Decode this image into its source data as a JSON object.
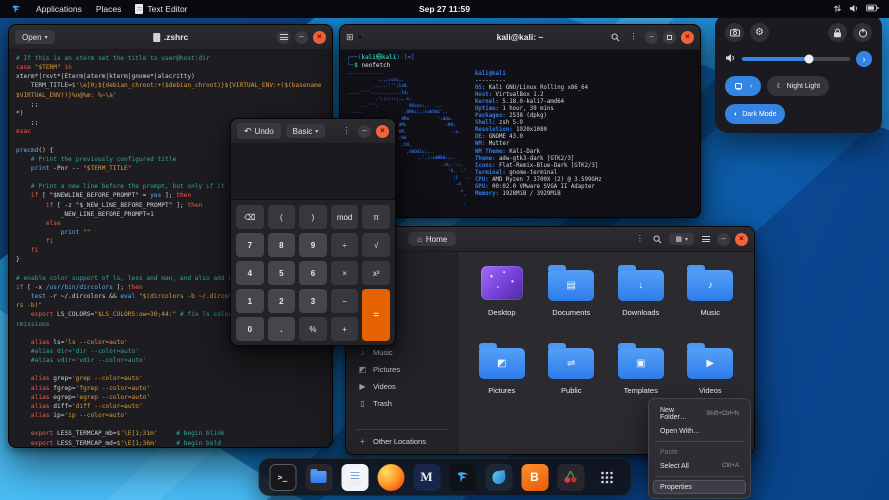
{
  "topbar": {
    "applications": "Applications",
    "places": "Places",
    "focused_app": "Text Editor",
    "clock": "Sep 27 11:59"
  },
  "editor": {
    "open_label": "Open",
    "title": ".zshrc",
    "code": [
      [
        [
          "c",
          "# If this is an xterm set the title to user@host:dir"
        ]
      ],
      [
        [
          "k",
          "case"
        ],
        [
          "p",
          " "
        ],
        [
          "s",
          "\"$TERM\""
        ],
        [
          "p",
          " "
        ],
        [
          "k",
          "in"
        ]
      ],
      [
        [
          "p",
          "xterm*|rxvt*|Eterm|aterm|kterm|gnome*|alacritty)"
        ]
      ],
      [
        [
          "p",
          "    TERM_TITLE="
        ],
        [
          "s",
          "$'\\e]0;${debian_chroot:+($debian_chroot)}${VIRTUAL_ENV:+($(basename $VIRTUAL_ENV))}%n@%m: %~\\a'"
        ]
      ],
      [
        [
          "p",
          "    ;;"
        ]
      ],
      [
        [
          "p",
          "*)"
        ]
      ],
      [
        [
          "p",
          "    ;;"
        ]
      ],
      [
        [
          "k",
          "esac"
        ]
      ],
      [],
      [
        [
          "v",
          "precmd"
        ],
        [
          "p",
          "() {"
        ]
      ],
      [
        [
          "c",
          "    # Print the previously configured title"
        ]
      ],
      [
        [
          "p",
          "    "
        ],
        [
          "v",
          "print"
        ],
        [
          "p",
          " -Pnr -- "
        ],
        [
          "s",
          "\"$TERM_TITLE\""
        ]
      ],
      [],
      [
        [
          "c",
          "    # Print a new line before the prompt, but only if it is not the first line"
        ]
      ],
      [
        [
          "p",
          "    "
        ],
        [
          "k",
          "if"
        ],
        [
          "p",
          " [ \"$NEWLINE_BEFORE_PROMPT\" = "
        ],
        [
          "v",
          "yes"
        ],
        [
          "p",
          " ]; "
        ],
        [
          "k",
          "then"
        ]
      ],
      [
        [
          "p",
          "        "
        ],
        [
          "k",
          "if"
        ],
        [
          "p",
          " [ -z \"$_NEW_LINE_BEFORE_PROMPT\" ]; "
        ],
        [
          "k",
          "then"
        ]
      ],
      [
        [
          "p",
          "            _NEW_LINE_BEFORE_PROMPT=1"
        ]
      ],
      [
        [
          "p",
          "        "
        ],
        [
          "k",
          "else"
        ]
      ],
      [
        [
          "p",
          "            "
        ],
        [
          "v",
          "print"
        ],
        [
          "p",
          " "
        ],
        [
          "s",
          "\"\""
        ]
      ],
      [
        [
          "p",
          "        "
        ],
        [
          "k",
          "fi"
        ]
      ],
      [
        [
          "p",
          "    "
        ],
        [
          "k",
          "fi"
        ]
      ],
      [
        [
          "p",
          "}"
        ]
      ],
      [],
      [
        [
          "c",
          "# enable color support of ls, less and man, and also add handy aliases"
        ]
      ],
      [
        [
          "k",
          "if"
        ],
        [
          "p",
          " [ -x "
        ],
        [
          "v",
          "/usr/bin/dircolors"
        ],
        [
          "p",
          " ]; "
        ],
        [
          "k",
          "then"
        ]
      ],
      [
        [
          "p",
          "    "
        ],
        [
          "v",
          "test"
        ],
        [
          "p",
          " -r ~/.dircolors && "
        ],
        [
          "v",
          "eval"
        ],
        [
          "p",
          " "
        ],
        [
          "s",
          "\"$(dircolors -b ~/.dircolors)\""
        ],
        [
          "p",
          " || "
        ],
        [
          "v",
          "eval"
        ],
        [
          "p",
          " "
        ],
        [
          "s",
          "\"$(dircolors -b)\""
        ]
      ],
      [
        [
          "p",
          "    "
        ],
        [
          "k",
          "export"
        ],
        [
          "p",
          " LS_COLORS="
        ],
        [
          "s",
          "\"$LS_COLORS:ow=30;44:\""
        ],
        [
          "p",
          " "
        ],
        [
          "c",
          "# fix ls color for folders with 777 permissions"
        ]
      ],
      [],
      [
        [
          "p",
          "    "
        ],
        [
          "k",
          "alias"
        ],
        [
          "p",
          " ls="
        ],
        [
          "s",
          "'ls --color=auto'"
        ]
      ],
      [
        [
          "c",
          "    #alias dir='dir --color=auto'"
        ]
      ],
      [
        [
          "c",
          "    #alias vdir='vdir --color=auto'"
        ]
      ],
      [],
      [
        [
          "p",
          "    "
        ],
        [
          "k",
          "alias"
        ],
        [
          "p",
          " grep="
        ],
        [
          "s",
          "'grep --color=auto'"
        ]
      ],
      [
        [
          "p",
          "    "
        ],
        [
          "k",
          "alias"
        ],
        [
          "p",
          " fgrep="
        ],
        [
          "s",
          "'fgrep --color=auto'"
        ]
      ],
      [
        [
          "p",
          "    "
        ],
        [
          "k",
          "alias"
        ],
        [
          "p",
          " egrep="
        ],
        [
          "s",
          "'egrep --color=auto'"
        ]
      ],
      [
        [
          "p",
          "    "
        ],
        [
          "k",
          "alias"
        ],
        [
          "p",
          " diff="
        ],
        [
          "s",
          "'diff --color=auto'"
        ]
      ],
      [
        [
          "p",
          "    "
        ],
        [
          "k",
          "alias"
        ],
        [
          "p",
          " ip="
        ],
        [
          "s",
          "'ip --color=auto'"
        ]
      ],
      [],
      [
        [
          "p",
          "    "
        ],
        [
          "k",
          "export"
        ],
        [
          "p",
          " LESS_TERMCAP_mb="
        ],
        [
          "s",
          "$'\\E[1;31m'"
        ],
        [
          "p",
          "     "
        ],
        [
          "c",
          "# begin blink"
        ]
      ],
      [
        [
          "p",
          "    "
        ],
        [
          "k",
          "export"
        ],
        [
          "p",
          " LESS_TERMCAP_md="
        ],
        [
          "s",
          "$'\\E[1;36m'"
        ],
        [
          "p",
          "     "
        ],
        [
          "c",
          "# begin bold"
        ]
      ]
    ]
  },
  "terminal": {
    "title": "kali@kali: ~",
    "prompt": [
      [
        [
          "frame",
          "┌──("
        ],
        [
          "user",
          "kali㉿kali"
        ],
        [
          "frame",
          ")-["
        ],
        [
          "path",
          "~"
        ],
        [
          "frame",
          "]"
        ]
      ],
      [
        [
          "frame",
          "└─"
        ],
        [
          "user",
          "$"
        ],
        [
          "plain",
          " neofetch"
        ]
      ]
    ],
    "neofetch": {
      "user_host": "kali@kali",
      "separator": "---------",
      "art": [
        "..............",
        "            ..,;:ccc,.",
        "          ......''';lxO.",
        ".....''''..........,:ld;",
        "           .';;;:::;,,.x,",
        "      ..'''.            0Xxoc:,.  ...",
        "  ....                ,ONkc;,;cokOdc',.",
        " .                   OMo           ':ddo.",
        "                    dMc               :OO;",
        "                    0M.                 .:o.",
        "                    ;Wd",
        "                     ;XO,",
        "                       ,d0Odlc;,..",
        "                           ..',;:cdOOd::,.",
        "                                    .:d;.':;.",
        "                                       'd,  .'",
        "                                         ;l   ..",
        "                                          .o",
        "                                            c",
        "                                            .'",
        "                                             ."
      ],
      "info": [
        [
          "OS",
          "Kali GNU/Linux Rolling x86_64"
        ],
        [
          "Host",
          "VirtualBox 1.2"
        ],
        [
          "Kernel",
          "5.18.0-kali7-amd64"
        ],
        [
          "Uptime",
          "1 hour, 39 mins"
        ],
        [
          "Packages",
          "2538 (dpkg)"
        ],
        [
          "Shell",
          "zsh 5.9"
        ],
        [
          "Resolution",
          "1920x1080"
        ],
        [
          "DE",
          "GNOME 43.0"
        ],
        [
          "WM",
          "Mutter"
        ],
        [
          "WM Theme",
          "Kali-Dark"
        ],
        [
          "Theme",
          "adw-gtk3-dark [GTK2/3]"
        ],
        [
          "Icons",
          "Flat-Remix-Blue-Dark [GTK2/3]"
        ],
        [
          "Terminal",
          "gnome-terminal"
        ],
        [
          "CPU",
          "AMD Ryzen 7 3700X (2) @ 3.599GHz"
        ],
        [
          "GPU",
          "00:02.0 VMware SVGA II Adapter"
        ],
        [
          "Memory",
          "1928MiB / 3929MiB"
        ]
      ]
    }
  },
  "calculator": {
    "undo_label": "Undo",
    "mode_label": "Basic",
    "display": "",
    "buttons": [
      {
        "t": "⌫",
        "n": "backspace",
        "k": "fn"
      },
      {
        "t": "(",
        "n": "paren-open",
        "k": "fn"
      },
      {
        "t": ")",
        "n": "paren-close",
        "k": "fn"
      },
      {
        "t": "mod",
        "n": "mod",
        "k": "fn"
      },
      {
        "t": "π",
        "n": "pi",
        "k": "fn"
      },
      {
        "t": "7",
        "n": "7",
        "k": "num"
      },
      {
        "t": "8",
        "n": "8",
        "k": "num"
      },
      {
        "t": "9",
        "n": "9",
        "k": "num"
      },
      {
        "t": "÷",
        "n": "divide",
        "k": "fn"
      },
      {
        "t": "√",
        "n": "sqrt",
        "k": "fn"
      },
      {
        "t": "4",
        "n": "4",
        "k": "num"
      },
      {
        "t": "5",
        "n": "5",
        "k": "num"
      },
      {
        "t": "6",
        "n": "6",
        "k": "num"
      },
      {
        "t": "×",
        "n": "multiply",
        "k": "fn"
      },
      {
        "t": "x²",
        "n": "square",
        "k": "fn"
      },
      {
        "t": "1",
        "n": "1",
        "k": "num"
      },
      {
        "t": "2",
        "n": "2",
        "k": "num"
      },
      {
        "t": "3",
        "n": "3",
        "k": "num"
      },
      {
        "t": "−",
        "n": "subtract",
        "k": "fn"
      },
      {
        "t": "=",
        "n": "equals",
        "k": "eq"
      },
      {
        "t": "0",
        "n": "0",
        "k": "num"
      },
      {
        "t": ".",
        "n": "point",
        "k": "num"
      },
      {
        "t": "%",
        "n": "percent",
        "k": "fn"
      },
      {
        "t": "+",
        "n": "add",
        "k": "fn"
      }
    ]
  },
  "files": {
    "breadcrumb": "Home",
    "view_toggle_glyph": "▦",
    "sidebar": [
      {
        "icon": "♪",
        "icon_name": "music-note-icon",
        "label": "Music"
      },
      {
        "icon": "◩",
        "icon_name": "picture-icon",
        "label": "Pictures"
      },
      {
        "icon": "▶",
        "icon_name": "video-icon",
        "label": "Videos"
      },
      {
        "icon": "▯",
        "icon_name": "trash-icon",
        "label": "Trash"
      },
      {
        "icon": "+",
        "icon_name": "plus-icon",
        "label": "Other Locations",
        "bottom": true
      }
    ],
    "folders": [
      {
        "name": "Desktop",
        "type": "desktop"
      },
      {
        "name": "Documents",
        "emblem": "▤",
        "emblem_name": "document-emblem-icon"
      },
      {
        "name": "Downloads",
        "emblem": "↓",
        "emblem_name": "download-emblem-icon"
      },
      {
        "name": "Music",
        "emblem": "♪",
        "emblem_name": "music-emblem-icon"
      },
      {
        "name": "Pictures",
        "emblem": "◩",
        "emblem_name": "picture-emblem-icon"
      },
      {
        "name": "Public",
        "emblem": "⇌",
        "emblem_name": "share-emblem-icon"
      },
      {
        "name": "Templates",
        "emblem": "▣",
        "emblem_name": "template-emblem-icon"
      },
      {
        "name": "Videos",
        "emblem": "▶",
        "emblem_name": "video-emblem-icon"
      }
    ]
  },
  "context_menu": {
    "items": [
      {
        "label": "New Folder…",
        "shortcut": "Shift+Ctrl+N"
      },
      {
        "label": "Open With…"
      },
      {
        "type": "sep"
      },
      {
        "label": "Paste",
        "disabled": true
      },
      {
        "label": "Select All",
        "shortcut": "Ctrl+A"
      },
      {
        "type": "sep"
      },
      {
        "label": "Properties",
        "focused": true
      }
    ]
  },
  "quick_settings": {
    "night_light": "Night Light",
    "dark_mode": "Dark Mode",
    "volume_percent": 62
  },
  "dock": {
    "apps": [
      {
        "app": "terminal"
      },
      {
        "app": "files"
      },
      {
        "app": "text-editor"
      },
      {
        "app": "firefox"
      },
      {
        "app": "metasploit"
      },
      {
        "app": "kali-tools"
      },
      {
        "app": "wireshark"
      },
      {
        "app": "burpsuite"
      },
      {
        "app": "cherrytree"
      },
      {
        "app": "show-apps"
      }
    ]
  },
  "colors": {
    "accent": "#3584e4",
    "close_button": "#f4633c",
    "equals_button": "#e66100",
    "kali_prompt_blue": "#2f7ce8",
    "folder_blue": "#2e7ceb"
  }
}
